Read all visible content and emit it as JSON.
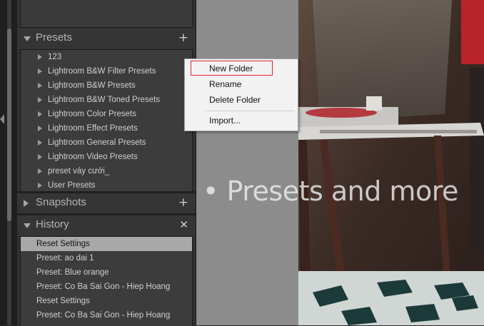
{
  "presets_panel": {
    "title": "Presets",
    "add_symbol": "+",
    "items": [
      {
        "label": "123"
      },
      {
        "label": "Lightroom B&W Filter Presets"
      },
      {
        "label": "Lightroom B&W Presets"
      },
      {
        "label": "Lightroom B&W Toned Presets"
      },
      {
        "label": "Lightroom Color Presets"
      },
      {
        "label": "Lightroom Effect Presets"
      },
      {
        "label": "Lightroom General Presets"
      },
      {
        "label": "Lightroom Video Presets"
      },
      {
        "label": "preset váy cưới_"
      },
      {
        "label": "User Presets"
      }
    ]
  },
  "snapshots_panel": {
    "title": "Snapshots",
    "add_symbol": "+"
  },
  "history_panel": {
    "title": "History",
    "close_symbol": "✕",
    "items": [
      {
        "label": "Reset Settings",
        "selected": true
      },
      {
        "label": "Preset: ao dai 1"
      },
      {
        "label": "Preset: Blue orange"
      },
      {
        "label": "Preset: Co Ba Sai Gon - Hiep Hoang"
      },
      {
        "label": "Reset Settings"
      },
      {
        "label": "Preset: Co Ba Sai Gon - Hiep Hoang"
      }
    ]
  },
  "context_menu": {
    "items": [
      {
        "label": "New Folder",
        "highlighted": true
      },
      {
        "label": "Rename"
      },
      {
        "label": "Delete Folder"
      },
      {
        "label": "Import..."
      }
    ]
  },
  "overlay": {
    "text": "• Presets and more"
  },
  "colors": {
    "highlight_box": "#e0262f",
    "panel_bg": "#323232",
    "selected_row": "#a8a8a8"
  }
}
